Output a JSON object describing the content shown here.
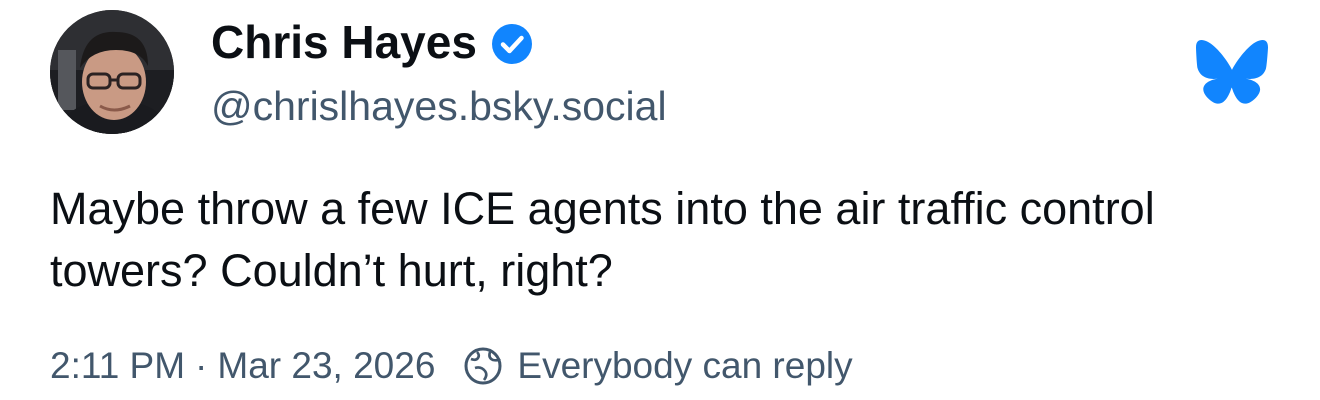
{
  "author": {
    "display_name": "Chris Hayes",
    "handle": "@chrislhayes.bsky.social",
    "verified": true,
    "avatar_icon": "profile-photo"
  },
  "post": {
    "text": "Maybe throw a few ICE agents into the air traffic control towers? Couldn’t hurt, right?"
  },
  "meta": {
    "time": "2:11 PM",
    "separator": "·",
    "date": "Mar 23, 2026",
    "reply_setting": "Everybody can reply",
    "reply_icon": "globe-reply-icon"
  },
  "brand": {
    "logo": "bluesky-butterfly-icon",
    "accent": "#1185fe"
  },
  "colors": {
    "text": "#0b0f14",
    "secondary": "#42576c",
    "verified": "#1185fe",
    "background": "#ffffff"
  }
}
